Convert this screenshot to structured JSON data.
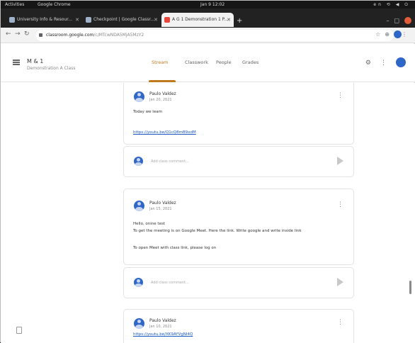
{
  "system_bar": {
    "activities": "Activities",
    "app_name": "Google Chrome",
    "clock": "Jan 9 12:02",
    "tray": "en ⟲ ◀ ⏻"
  },
  "browser": {
    "tabs": [
      {
        "label": "University Info & Resour..."
      },
      {
        "label": "Checkpoint | Google Classr..."
      },
      {
        "label": "A G 1 Demonstration 1 P..."
      }
    ],
    "new_tab": "+",
    "omnibox": {
      "domain": "classroom.google.com",
      "path": "/c/MTcwNDA5MjA5MzY2"
    }
  },
  "classroom": {
    "class_name": "M & 1",
    "class_subtitle": "Demonstration A Class",
    "tabs": [
      {
        "label": "Stream"
      },
      {
        "label": "Classwork"
      },
      {
        "label": "People"
      },
      {
        "label": "Grades"
      }
    ]
  },
  "posts": [
    {
      "author": "Paulo Valdez",
      "date": "Jan 20, 2021",
      "lines": [
        "Today we learn"
      ],
      "link": "https://youtu.be/Q1cQ8mB9xdM"
    },
    {
      "author": "Paulo Valdez",
      "date": "Jan 15, 2021",
      "lines": [
        "Hello, onine test",
        "To get the meeting is on Google Meet. Here the link. Write google and write inside link",
        "To open Meet with class link, please log on"
      ],
      "link": ""
    },
    {
      "author": "Paulo Valdez",
      "date": "Jan 10, 2021",
      "lines": [],
      "link": "https://youtu.be/XK9AYVgNI4Q"
    }
  ],
  "comment_placeholder": "Add class comment..."
}
